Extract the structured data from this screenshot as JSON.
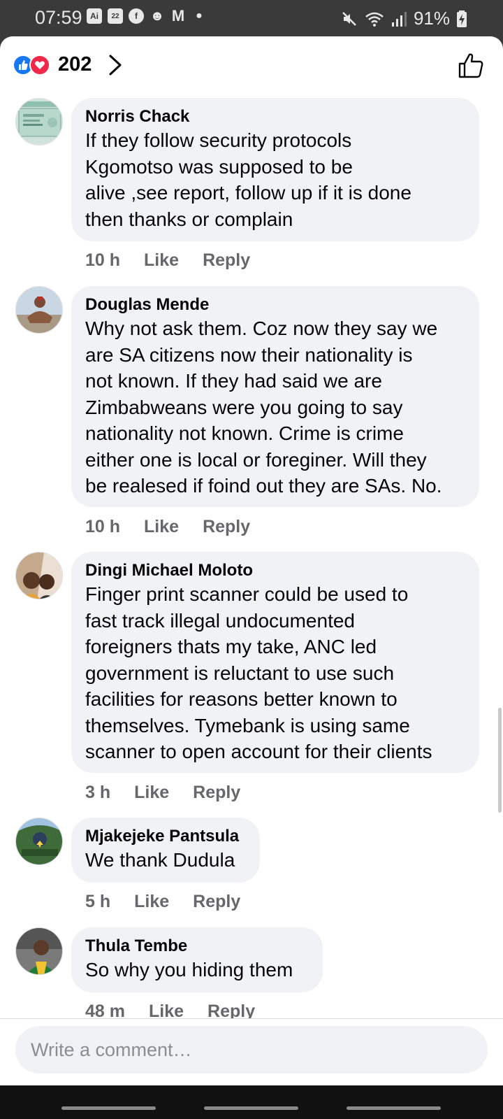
{
  "status_bar": {
    "time": "07:59",
    "left_icons": [
      "ai-icon",
      "calendar-icon",
      "facebook-icon",
      "snapchat-icon",
      "gmail-icon",
      "dot-icon"
    ],
    "calendar_day": "22",
    "ai_label": "Ai",
    "battery": "91%"
  },
  "reactions": {
    "count": "202",
    "types": [
      "like",
      "love"
    ]
  },
  "comments": [
    {
      "author": "Norris Chack",
      "text": "If they  follow security protocols\nKgomotso was supposed to be\nalive  ,see report, follow up if it is done\nthen thanks or complain",
      "time": "10 h",
      "like_label": "Like",
      "reply_label": "Reply"
    },
    {
      "author": "Douglas Mende",
      "text": "Why not ask them. Coz now they say we\nare SA citizens now their nationality is\nnot known. If they had said we are\nZimbabweans were you going to say\nnationality not known. Crime is crime\neither one is local or foreginer. Will they\nbe realesed if foind out they are SAs. No.",
      "time": "10 h",
      "like_label": "Like",
      "reply_label": "Reply"
    },
    {
      "author": "Dingi Michael Moloto",
      "text": "Finger print scanner could be used to\nfast track illegal undocumented\nforeigners thats my take, ANC led\ngovernment is reluctant to use such\nfacilities for reasons better known to\nthemselves. Tymebank is using same\nscanner to open account for their clients",
      "time": "3 h",
      "like_label": "Like",
      "reply_label": "Reply"
    },
    {
      "author": "Mjakejeke Pantsula",
      "text": "We thank Dudula",
      "time": "5 h",
      "like_label": "Like",
      "reply_label": "Reply"
    },
    {
      "author": "Thula Tembe",
      "text": "So why you hiding them",
      "time": "48 m",
      "like_label": "Like",
      "reply_label": "Reply"
    }
  ],
  "compose": {
    "placeholder": "Write a comment…"
  },
  "colors": {
    "bubble_bg": "#f0f2f5",
    "meta_text": "#65676b",
    "like_blue": "#1877f2",
    "love_red": "#f0284a"
  }
}
